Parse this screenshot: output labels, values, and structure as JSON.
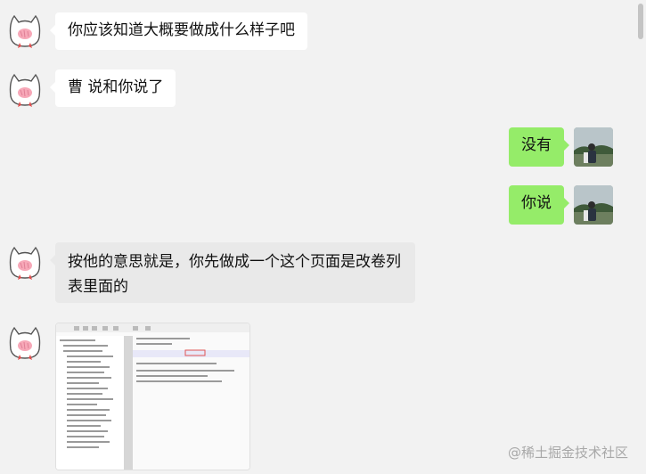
{
  "messages": [
    {
      "from": "other",
      "text": "你应该知道大概要做成什么样子吧"
    },
    {
      "from": "other",
      "text": "曹 说和你说了"
    },
    {
      "from": "me",
      "text": "没有"
    },
    {
      "from": "me",
      "text": "你说"
    },
    {
      "from": "other",
      "text": "按他的意思就是，你先做成一个这个页面是改卷列表里面的"
    }
  ],
  "watermark": "@稀土掘金技术社区",
  "colors": {
    "background": "#f2f2f2",
    "own_bubble": "#95ec69",
    "other_bubble": "#ffffff",
    "highlight_bubble": "#e9e9e9"
  },
  "icons": {
    "other_avatar": "cat-avatar-icon",
    "own_avatar": "user-photo-avatar"
  }
}
